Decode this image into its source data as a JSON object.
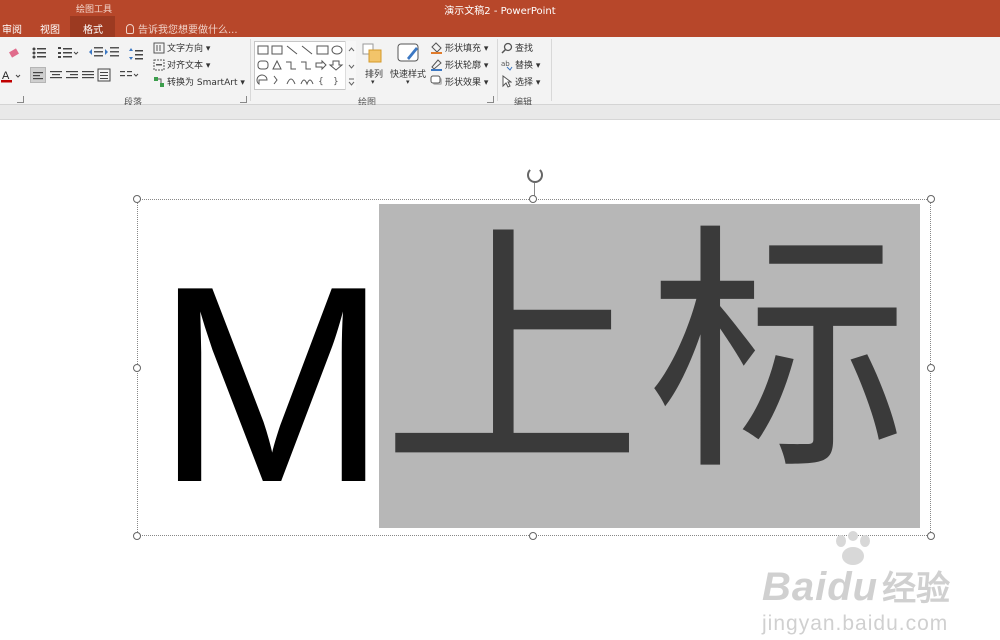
{
  "titlebar": {
    "context_label": "绘图工具",
    "doc_title": "演示文稿2 - PowerPoint",
    "tabs": [
      {
        "label": "审阅"
      },
      {
        "label": "视图"
      },
      {
        "label": "格式"
      }
    ],
    "tell_me": "告诉我您想要做什么..."
  },
  "ribbon": {
    "paragraph": {
      "label": "段落",
      "text_direction": "文字方向",
      "align_text": "对齐文本",
      "convert_smartart": "转换为 SmartArt"
    },
    "drawing": {
      "label": "绘图",
      "arrange": "排列",
      "quick_styles": "快速样式",
      "shape_fill": "形状填充",
      "shape_outline": "形状轮廓",
      "shape_effects": "形状效果"
    },
    "editing": {
      "label": "编辑",
      "find": "查找",
      "replace": "替换",
      "select": "选择"
    }
  },
  "slide": {
    "text_plain": "M",
    "text_selected": "上标"
  },
  "watermark": {
    "brand": "Baidu",
    "cn": "经验",
    "url": "jingyan.baidu.com"
  },
  "colors": {
    "titlebar": "#b7472a",
    "ribbon": "#f3f3f3",
    "selection": "#b7b7b7"
  }
}
